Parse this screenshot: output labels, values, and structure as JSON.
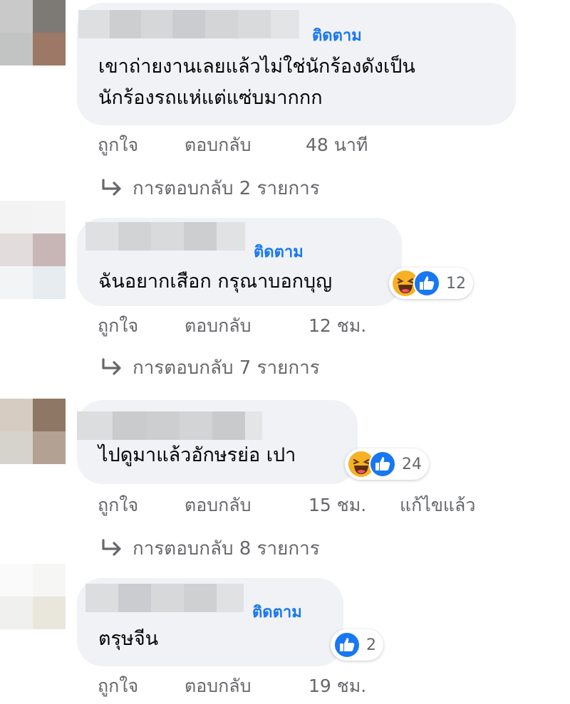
{
  "colors": {
    "bubble_bg": "#f0f2f5",
    "follow_blue": "#1877f2",
    "meta_gray": "#65676b",
    "like_blue": "#1877f2",
    "haha_yellow": "#f7b125"
  },
  "comments": [
    {
      "follow_label": "ติดตาม",
      "text_lines": [
        "เขาถ่ายงานเลยแล้วไม่ใช่นักร้องดังเป็น",
        "นักร้องรถแห่แต่แซ่บมากกก"
      ],
      "like_label": "ถูกใจ",
      "reply_label": "ตอบกลับ",
      "time": "48 นาที",
      "replies_label": "การตอบกลับ 2 รายการ"
    },
    {
      "follow_label": "ติดตาม",
      "text_lines": [
        "ฉันอยากเสือก กรุณาบอกบุญ"
      ],
      "reactions": [
        "haha-icon",
        "like-icon"
      ],
      "reaction_count": "12",
      "like_label": "ถูกใจ",
      "reply_label": "ตอบกลับ",
      "time": "12 ชม.",
      "replies_label": "การตอบกลับ 7 รายการ"
    },
    {
      "text_lines": [
        "ไปดูมาแล้วอักษรย่อ เปา"
      ],
      "reactions": [
        "haha-icon",
        "like-icon"
      ],
      "reaction_count": "24",
      "like_label": "ถูกใจ",
      "reply_label": "ตอบกลับ",
      "time": "15 ชม.",
      "edited_label": "แก้ไขแล้ว",
      "replies_label": "การตอบกลับ 8 รายการ"
    },
    {
      "follow_label": "ติดตาม",
      "text_lines": [
        "ตรุษจีน"
      ],
      "reactions": [
        "like-icon"
      ],
      "reaction_count": "2",
      "like_label": "ถูกใจ",
      "reply_label": "ตอบกลับ",
      "time": "19 ชม."
    }
  ]
}
